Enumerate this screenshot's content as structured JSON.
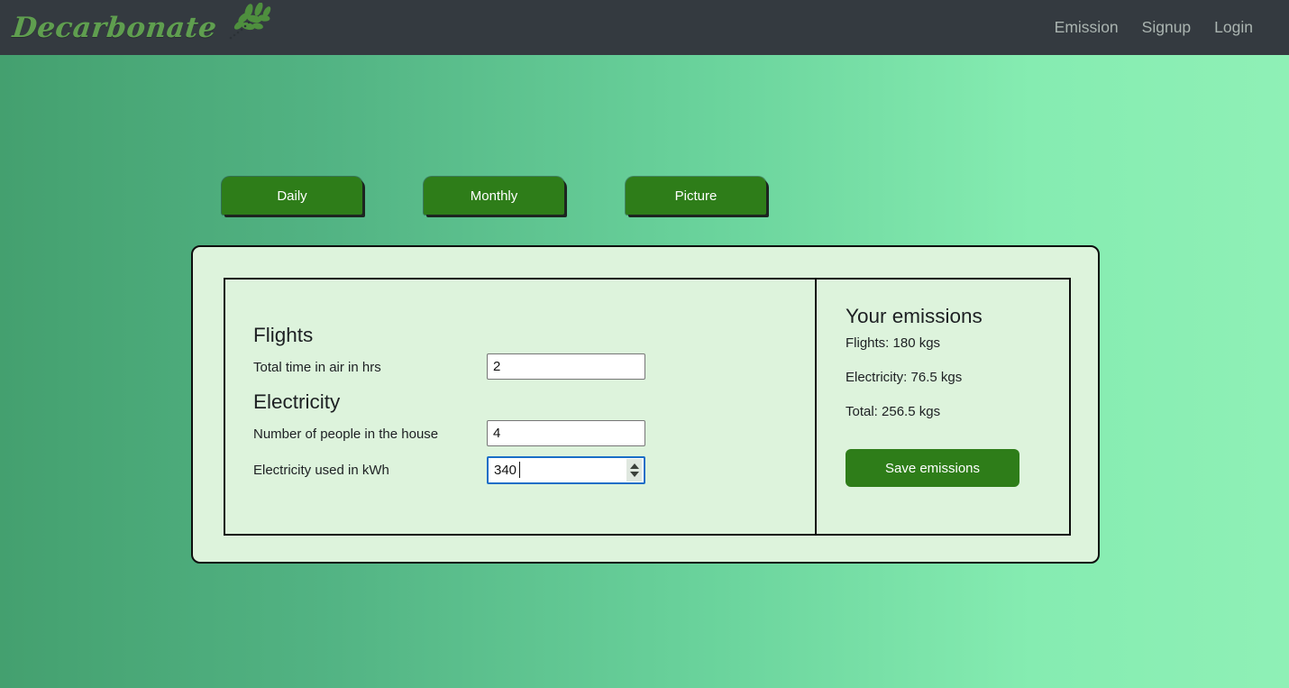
{
  "brand": {
    "name": "Decarbonate",
    "leaf_icon": "leaf-branch-icon",
    "color": "#5f9e4f"
  },
  "nav": {
    "links": [
      {
        "label": "Emission"
      },
      {
        "label": "Signup"
      },
      {
        "label": "Login"
      }
    ],
    "bar_color": "#343a40",
    "link_color": "#aab4b0"
  },
  "tabs": [
    {
      "label": "Daily"
    },
    {
      "label": "Monthly"
    },
    {
      "label": "Picture"
    }
  ],
  "form": {
    "sections": [
      {
        "title": "Flights"
      },
      {
        "title": "Electricity"
      }
    ],
    "fields": {
      "flight_hours": {
        "label": "Total time in air in hrs",
        "value": "2",
        "placeholder": ""
      },
      "house_people": {
        "label": "Number of people in the house",
        "value": "4",
        "placeholder": ""
      },
      "electricity_kwh": {
        "label": "Electricity used in kWh",
        "value": "340",
        "placeholder": "",
        "focused": true
      }
    }
  },
  "summary": {
    "title": "Your emissions",
    "lines": [
      {
        "text": "Flights: 180 kgs"
      },
      {
        "text": "Electricity: 76.5 kgs"
      },
      {
        "text": "Total: 256.5 kgs"
      }
    ],
    "save_label": "Save emissions"
  },
  "theme": {
    "button_green": "#2e7d19",
    "panel_bg": "#ddf3dc",
    "page_gradient_start": "#44a06f",
    "page_gradient_end": "#8ff0b6",
    "focus_blue": "#1a6ec7"
  }
}
